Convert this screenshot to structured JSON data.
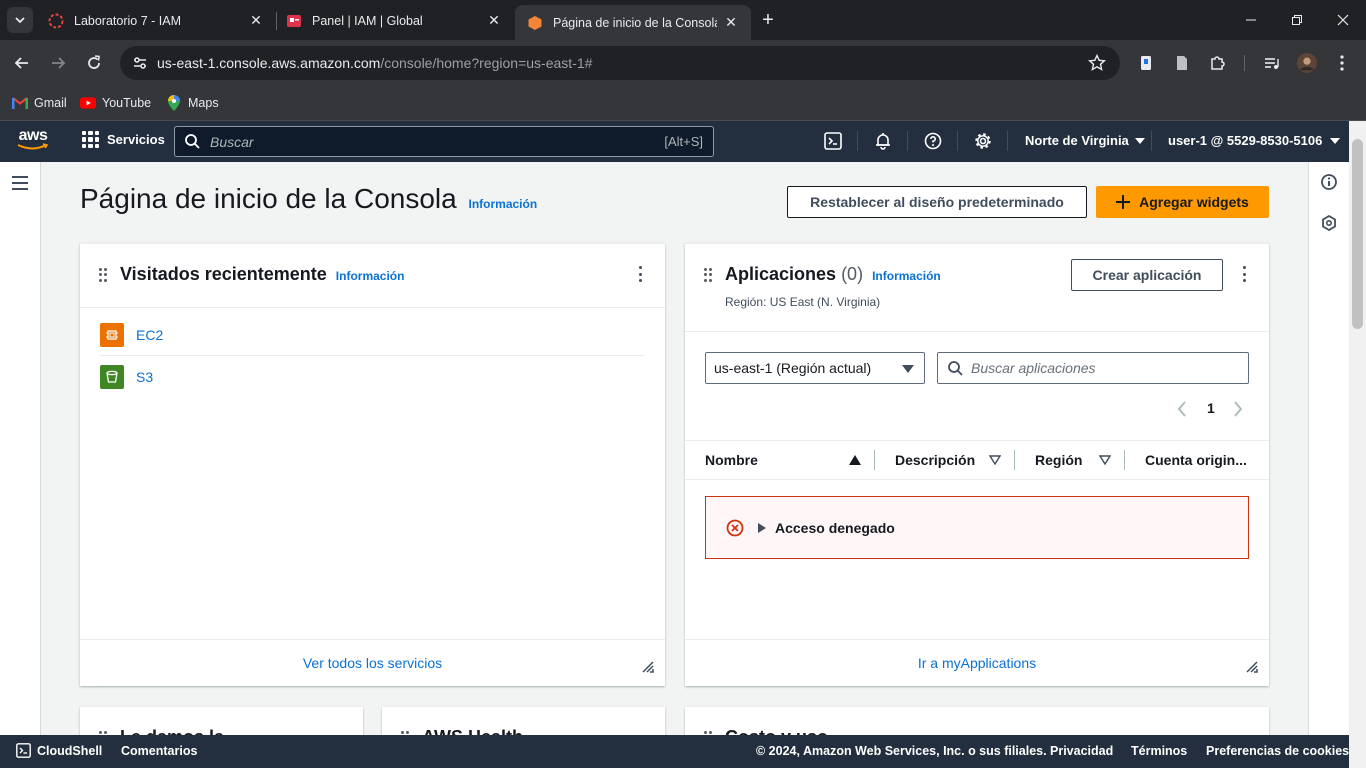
{
  "browser": {
    "tabs": [
      {
        "title": "Laboratorio 7 - IAM",
        "icon": "loading-spinner-icon",
        "active": false
      },
      {
        "title": "Panel | IAM | Global",
        "icon": "iam-icon",
        "active": false
      },
      {
        "title": "Página de inicio de la Consola |",
        "icon": "aws-cube-icon",
        "active": true
      }
    ],
    "url_host": "us-east-1.console.aws.amazon.com",
    "url_path": "/console/home?region=us-east-1#",
    "bookmarks": [
      {
        "label": "Gmail",
        "icon": "gmail-icon"
      },
      {
        "label": "YouTube",
        "icon": "youtube-icon"
      },
      {
        "label": "Maps",
        "icon": "maps-icon"
      }
    ]
  },
  "aws_nav": {
    "logo": "aws",
    "services_label": "Servicios",
    "search_placeholder": "Buscar",
    "search_shortcut": "[Alt+S]",
    "region_label": "Norte de Virginia",
    "user_label": "user-1 @ 5529-8530-5106"
  },
  "page": {
    "title": "Página de inicio de la Consola",
    "info_label": "Información",
    "reset_button": "Restablecer al diseño predeterminado",
    "add_widgets_button": "Agregar widgets"
  },
  "recent_widget": {
    "title": "Visitados recientemente",
    "info_label": "Información",
    "services": [
      {
        "label": "EC2",
        "color": "#ed7100"
      },
      {
        "label": "S3",
        "color": "#3f8624"
      }
    ],
    "footer_link": "Ver todos los servicios"
  },
  "apps_widget": {
    "title": "Aplicaciones",
    "count": "(0)",
    "info_label": "Información",
    "region_text": "Región: US East (N. Virginia)",
    "create_button": "Crear aplicación",
    "region_select": "us-east-1 (Región actual)",
    "search_placeholder": "Buscar aplicaciones",
    "page_number": "1",
    "columns": [
      "Nombre",
      "Descripción",
      "Región",
      "Cuenta origin..."
    ],
    "alert_text": "Acceso denegado",
    "footer_link": "Ir a myApplications"
  },
  "lower_widgets": [
    "Le damos la ...",
    "AWS Health",
    "Costo y uso"
  ],
  "footer": {
    "cloudshell": "CloudShell",
    "comments": "Comentarios",
    "copyright": "© 2024, Amazon Web Services, Inc. o sus filiales.",
    "privacy": "Privacidad",
    "terms": "Términos",
    "cookies": "Preferencias de cookies"
  },
  "colors": {
    "aws_nav_bg": "#232f3e",
    "accent_orange": "#ff9900",
    "link_blue": "#0972d3",
    "error_red": "#d13212"
  }
}
